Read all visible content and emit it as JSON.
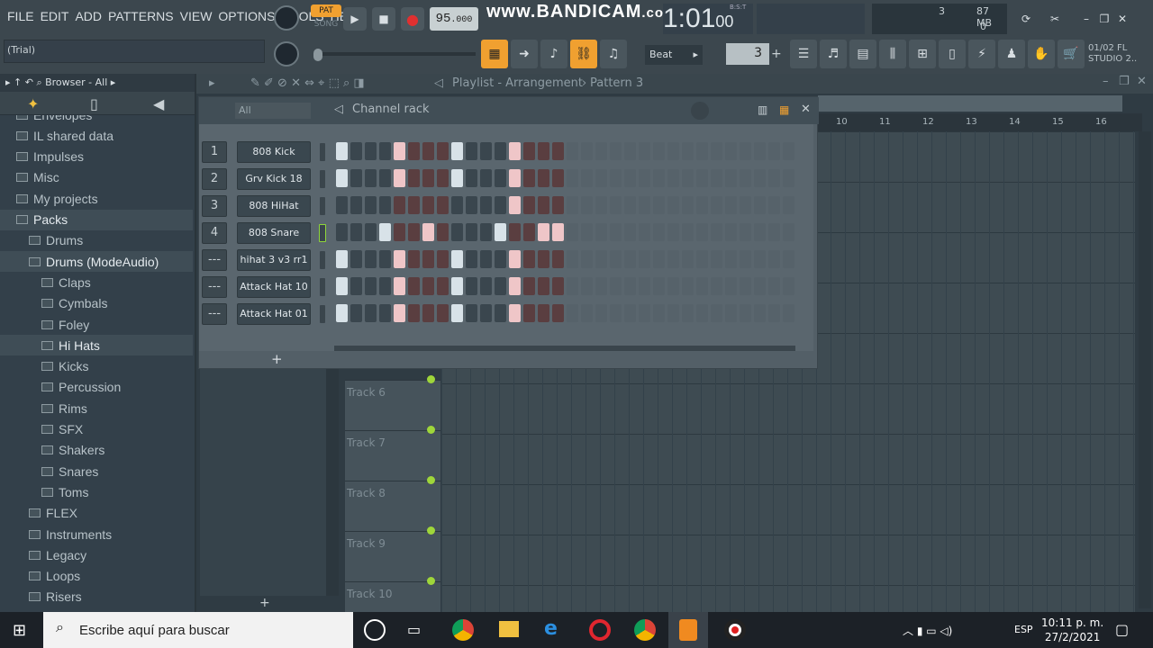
{
  "menu": [
    "FILE",
    "EDIT",
    "ADD",
    "PATTERNS",
    "VIEW",
    "OPTIONS",
    "TOOLS",
    "HELP"
  ],
  "hint": "(Trial)",
  "transport": {
    "pat": "PAT",
    "song": "SONG",
    "tempo": "95",
    "tempo_dec": ".000"
  },
  "watermark": {
    "main": "www.BANDICAM",
    "suffix": ".com"
  },
  "time": {
    "value": "1:01",
    "sub": "00",
    "label": "B:S:T"
  },
  "monitor": {
    "voices": "3",
    "memory": "87 MB",
    "cpu": "0"
  },
  "snap": {
    "label": "Beat",
    "pattern_number": "3"
  },
  "fl": {
    "version": "01/02",
    "line1": "FL",
    "line2": "STUDIO 2.."
  },
  "browser": {
    "title": "Browser - All",
    "items": [
      {
        "label": "Envelopes",
        "level": 0
      },
      {
        "label": "IL shared data",
        "level": 0
      },
      {
        "label": "Impulses",
        "level": 0
      },
      {
        "label": "Misc",
        "level": 0
      },
      {
        "label": "My projects",
        "level": 0
      },
      {
        "label": "Packs",
        "level": 0
      },
      {
        "label": "Drums",
        "level": 1
      },
      {
        "label": "Drums (ModeAudio)",
        "level": 1
      },
      {
        "label": "Claps",
        "level": 2
      },
      {
        "label": "Cymbals",
        "level": 2
      },
      {
        "label": "Foley",
        "level": 2
      },
      {
        "label": "Hi Hats",
        "level": 2
      },
      {
        "label": "Kicks",
        "level": 2
      },
      {
        "label": "Percussion",
        "level": 2
      },
      {
        "label": "Rims",
        "level": 2
      },
      {
        "label": "SFX",
        "level": 2
      },
      {
        "label": "Shakers",
        "level": 2
      },
      {
        "label": "Snares",
        "level": 2
      },
      {
        "label": "Toms",
        "level": 2
      },
      {
        "label": "FLEX",
        "level": 1
      },
      {
        "label": "Instruments",
        "level": 1
      },
      {
        "label": "Legacy",
        "level": 1
      },
      {
        "label": "Loops",
        "level": 1
      },
      {
        "label": "Risers",
        "level": 1
      }
    ]
  },
  "playlist": {
    "title": "Playlist - Arrangement",
    "pattern": "Pattern 3",
    "ruler": [
      "10",
      "11",
      "12",
      "13",
      "14",
      "15",
      "16"
    ],
    "tracks": [
      "Track 6",
      "Track 7",
      "Track 8",
      "Track 9",
      "Track 10"
    ],
    "add": "+"
  },
  "rack": {
    "title": "Channel rack",
    "filter": "All",
    "add": "+",
    "channels": [
      {
        "num": "1",
        "name": "808 Kick",
        "steps": [
          1,
          0,
          0,
          0,
          1,
          0,
          0,
          0,
          1,
          0,
          0,
          0,
          1,
          0,
          0,
          0
        ]
      },
      {
        "num": "2",
        "name": "Grv Kick 18",
        "steps": [
          1,
          0,
          0,
          0,
          1,
          0,
          0,
          0,
          1,
          0,
          0,
          0,
          1,
          0,
          0,
          0
        ]
      },
      {
        "num": "3",
        "name": "808 HiHat",
        "steps": [
          0,
          0,
          0,
          0,
          0,
          0,
          0,
          0,
          0,
          0,
          0,
          0,
          1,
          0,
          0,
          0
        ]
      },
      {
        "num": "4",
        "name": "808 Snare",
        "steps": [
          0,
          0,
          0,
          1,
          0,
          0,
          1,
          0,
          0,
          0,
          0,
          1,
          0,
          0,
          1,
          1
        ]
      },
      {
        "num": "---",
        "name": "hihat 3 v3 rr1",
        "steps": [
          1,
          0,
          0,
          0,
          1,
          0,
          0,
          0,
          1,
          0,
          0,
          0,
          1,
          0,
          0,
          0
        ]
      },
      {
        "num": "---",
        "name": "Attack Hat 10",
        "steps": [
          1,
          0,
          0,
          0,
          1,
          0,
          0,
          0,
          1,
          0,
          0,
          0,
          1,
          0,
          0,
          0
        ]
      },
      {
        "num": "---",
        "name": "Attack Hat 01",
        "steps": [
          1,
          0,
          0,
          0,
          1,
          0,
          0,
          0,
          1,
          0,
          0,
          0,
          1,
          0,
          0,
          0
        ]
      }
    ]
  },
  "taskbar": {
    "search": "Escribe aquí para buscar",
    "lang": "ESP",
    "time": "10:11 p. m.",
    "date": "27/2/2021"
  },
  "colors": {
    "accent": "#f0a030",
    "led": "#9fd63a"
  }
}
